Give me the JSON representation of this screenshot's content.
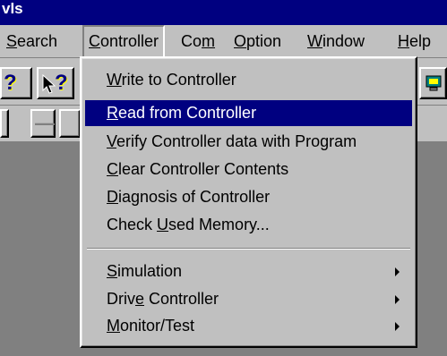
{
  "window": {
    "title": "vls"
  },
  "menubar": {
    "items": [
      {
        "pre": "",
        "mn": "S",
        "post": "earch"
      },
      {
        "pre": "",
        "mn": "C",
        "post": "ontroller"
      },
      {
        "pre": "Co",
        "mn": "m",
        "post": ""
      },
      {
        "pre": "",
        "mn": "O",
        "post": "ption"
      },
      {
        "pre": "",
        "mn": "W",
        "post": "indow"
      },
      {
        "pre": "",
        "mn": "H",
        "post": "elp"
      }
    ]
  },
  "toolbar": {
    "help_glyph": "?",
    "context_help_glyph": "?",
    "minus_glyph": "—"
  },
  "controller_menu": {
    "items": [
      {
        "pre": "",
        "mn": "W",
        "post": "rite to Controller"
      },
      {
        "pre": "",
        "mn": "R",
        "post": "ead from Controller"
      },
      {
        "pre": "",
        "mn": "V",
        "post": "erify Controller data with Program"
      },
      {
        "pre": "",
        "mn": "C",
        "post": "lear Controller Contents"
      },
      {
        "pre": "",
        "mn": "D",
        "post": "iagnosis of Controller"
      },
      {
        "pre": "Check ",
        "mn": "U",
        "post": "sed Memory..."
      },
      {
        "pre": "",
        "mn": "S",
        "post": "imulation"
      },
      {
        "pre": "Driv",
        "mn": "e",
        "post": " Controller"
      },
      {
        "pre": "",
        "mn": "M",
        "post": "onitor/Test"
      }
    ]
  }
}
